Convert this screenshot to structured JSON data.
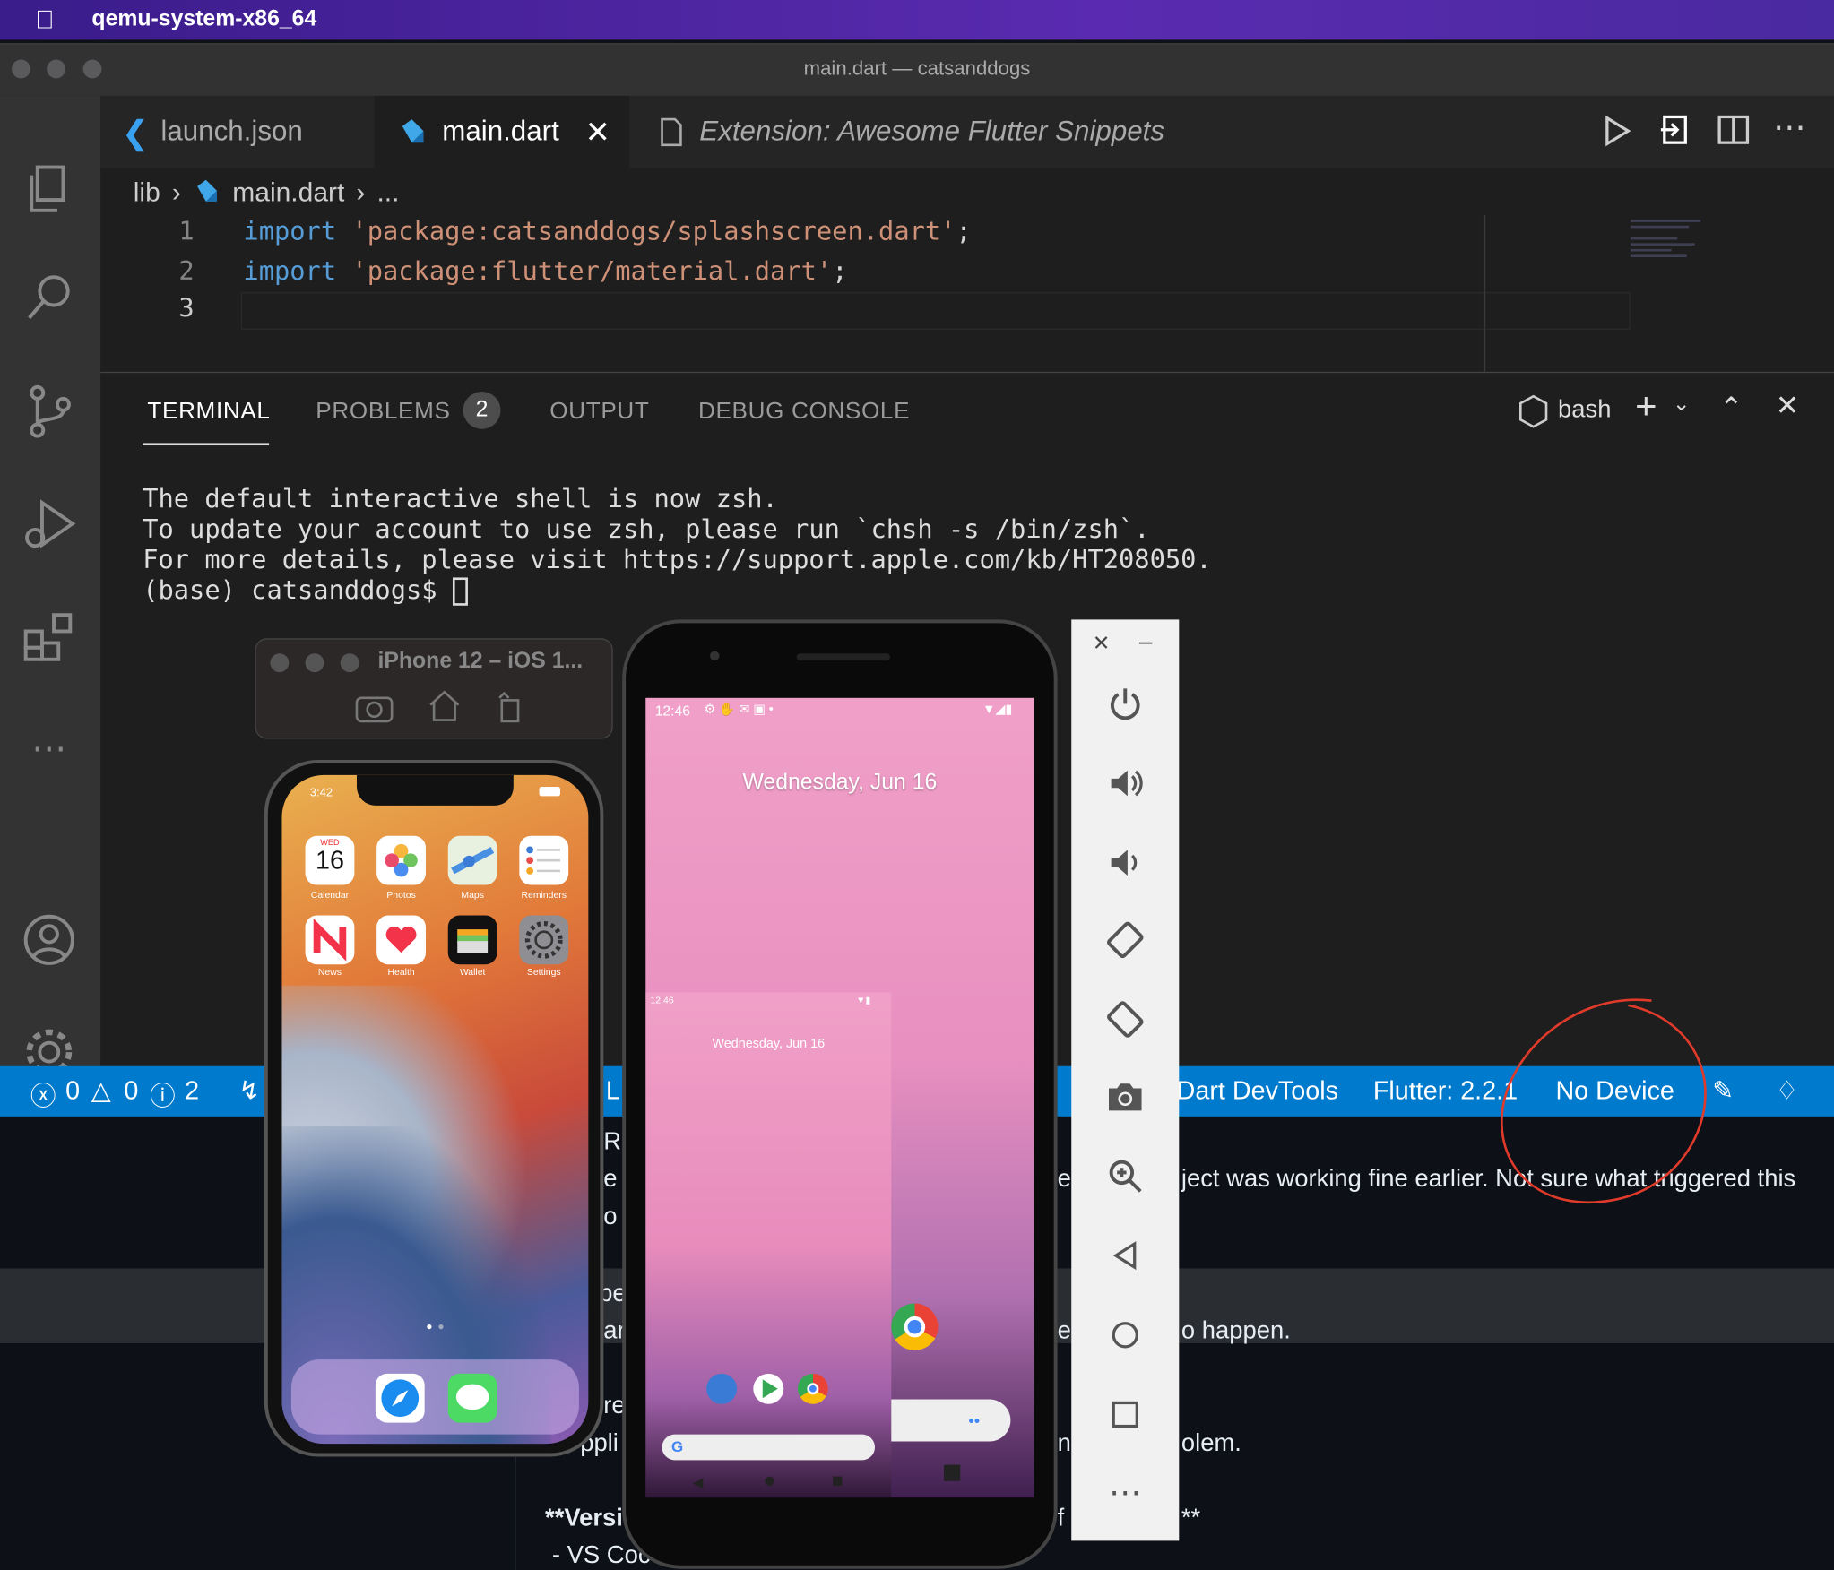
{
  "menubar": {
    "app_name": "qemu-system-x86_64"
  },
  "window": {
    "title": "main.dart — catsanddogs"
  },
  "tabs": [
    {
      "label": "launch.json",
      "icon": "vscode-icon"
    },
    {
      "label": "main.dart",
      "icon": "dart-icon",
      "active": true
    },
    {
      "label": "Extension: Awesome Flutter Snippets",
      "icon": "file-icon"
    }
  ],
  "breadcrumb": {
    "folder": "lib",
    "file": "main.dart",
    "more": "..."
  },
  "editor": {
    "line_numbers": [
      "1",
      "2",
      "3"
    ],
    "lines": [
      {
        "kw": "import",
        "str": "'package:catsanddogs/splashscreen.dart'",
        "end": ";"
      },
      {
        "kw": "import",
        "str": "'package:flutter/material.dart'",
        "end": ";"
      }
    ]
  },
  "panel": {
    "tabs": {
      "terminal": "TERMINAL",
      "problems": "PROBLEMS",
      "problems_count": "2",
      "output": "OUTPUT",
      "debug": "DEBUG CONSOLE"
    },
    "shell": "bash",
    "terminal_lines": [
      "The default interactive shell is now zsh.",
      "To update your account to use zsh, please run `chsh -s /bin/zsh`.",
      "For more details, please visit https://support.apple.com/kb/HT208050.",
      "(base) catsanddogs$ "
    ]
  },
  "status": {
    "errors": "0",
    "warnings": "0",
    "infos": "2",
    "devtools": "Dart DevTools",
    "flutter": "Flutter: 2.2.1",
    "device": "No Device",
    "partial_l": "L"
  },
  "background_text": {
    "line1": "ject was working fine earlier. Not sure what triggered this",
    "line2": "o happen.",
    "line3": "olem.",
    "line4": "**Versi",
    "line5": "- VS Coc",
    "frag_r": "R",
    "frag_e": "e",
    "frag_o": "o",
    "frag_pe": "pe",
    "frag_ar": "ar",
    "frag_re": "re",
    "frag_appl": "ppli",
    "frag_e2": "e",
    "frag_er": "er",
    "frag_n": "n",
    "frag_f": "f",
    "frag_stars": "**"
  },
  "ios": {
    "title": "iPhone 12 – iOS 1...",
    "time": "3:42",
    "calendar_day": "WED",
    "calendar_date": "16",
    "apps": [
      "Calendar",
      "Photos",
      "Maps",
      "Reminders",
      "News",
      "Health",
      "Wallet",
      "Settings"
    ]
  },
  "android": {
    "time": "12:46",
    "date": "Wednesday, Jun 16",
    "mini_time": "12:46",
    "mini_date": "Wednesday, Jun 16"
  },
  "colors": {
    "accent": "#007acc",
    "annotation": "#e03a2a"
  }
}
